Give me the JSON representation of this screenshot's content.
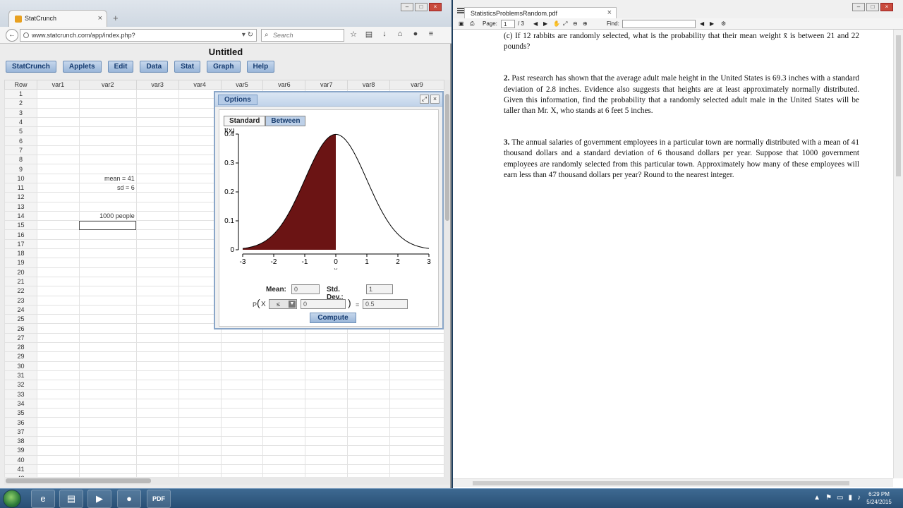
{
  "browser": {
    "tab_title": "StatCrunch",
    "url": "www.statcrunch.com/app/index.php?",
    "search_placeholder": "Search"
  },
  "app": {
    "title": "Untitled",
    "menu": [
      "StatCrunch",
      "Applets",
      "Edit",
      "Data",
      "Stat",
      "Graph",
      "Help"
    ]
  },
  "spreadsheet": {
    "columns": [
      "Row",
      "var1",
      "var2",
      "var3",
      "var4",
      "var5",
      "var6",
      "var7",
      "var8",
      "var9"
    ],
    "row_count": 42,
    "cells": {
      "10": "mean = 41",
      "11": "sd = 6",
      "14": "1000 people"
    },
    "selected_row": 15
  },
  "dialog": {
    "title": "Options",
    "tabs": [
      "Standard",
      "Between"
    ],
    "active_tab": "Between",
    "mean_label": "Mean:",
    "mean_value": "0",
    "sd_label": "Std. Dev.:",
    "sd_value": "1",
    "p_label": "P",
    "x_label": "X",
    "operator": "≤",
    "x_value": "0",
    "equals": "=",
    "result": "0.5",
    "compute_label": "Compute"
  },
  "chart_data": {
    "type": "area",
    "title": "",
    "xlabel": "x",
    "ylabel": "f(x)",
    "distribution": "normal",
    "mean": 0,
    "sd": 1,
    "xlim": [
      -3,
      3
    ],
    "ylim": [
      0,
      0.4
    ],
    "xticks": [
      "-3",
      "-2",
      "-1",
      "0",
      "1",
      "2",
      "3"
    ],
    "yticks": [
      "0",
      "0.1",
      "0.2",
      "0.3",
      "0.4"
    ],
    "shaded_region": {
      "from": -3,
      "to": 0
    },
    "colors": {
      "shade": "#6b1414",
      "curve": "#000000"
    }
  },
  "pdf_viewer": {
    "tab_title": "StatisticsProblemsRandom.pdf",
    "page_label": "Page:",
    "page_current": "1",
    "page_total": "/ 3",
    "find_label": "Find:",
    "paragraphs": [
      {
        "num": "",
        "text": "(c) If 12 rabbits are randomly selected, what is the probability that their mean weight x̄ is between 21 and 22 pounds?"
      },
      {
        "num": "2.",
        "text": "Past research has shown that the average adult male height in the United States is 69.3 inches with a standard deviation of 2.8 inches. Evidence also suggests that heights are at least approximately normally distributed. Given this information, find the probability that a randomly selected adult male in the United States will be taller than Mr. X, who stands at 6 feet 5 inches."
      },
      {
        "num": "3.",
        "text": "The annual salaries of government employees in a particular town are normally distributed with a mean of 41 thousand dollars and a standard deviation of 6 thousand dollars per year. Suppose that 1000 government employees are randomly selected from this particular town. Approximately how many of these employees will earn less than 47 thousand dollars per year? Round to the nearest integer."
      }
    ]
  },
  "taskbar": {
    "time": "6:29 PM",
    "date": "5/24/2015"
  }
}
